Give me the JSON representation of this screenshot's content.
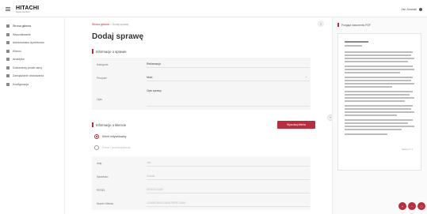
{
  "header": {
    "logo_main": "HITACHI",
    "logo_sub": "Inspire the Next",
    "user_name": "Jan Nowak"
  },
  "sidebar": {
    "items": [
      {
        "label": "Strona główna",
        "icon": "grid-icon"
      },
      {
        "label": "Wyszukiwanie",
        "icon": "search-icon"
      },
      {
        "label": "Administrator dyrektorów",
        "icon": "admin-icon"
      },
      {
        "label": "Klienci",
        "icon": "clients-icon"
      },
      {
        "label": "Analityka",
        "icon": "chart-icon"
      },
      {
        "label": "Dokumenty prośb ramy",
        "icon": "document-icon"
      },
      {
        "label": "Zarządzanie drukowania",
        "icon": "print-icon"
      },
      {
        "label": "Konfiguracja",
        "icon": "gear-icon"
      }
    ]
  },
  "main": {
    "breadcrumb": {
      "home": "Strona główna",
      "separator": ">",
      "current": "Dodaj sprawę"
    },
    "title": "Dodaj sprawę",
    "section1": {
      "title": "Informacje o sprawie",
      "rows": [
        {
          "label": "Kategoria",
          "value": "Reklamacja"
        },
        {
          "label": "Priorytet",
          "value": "Niski"
        },
        {
          "label": "Opis",
          "value": "Opis sprawy"
        }
      ]
    },
    "section2": {
      "title": "Informacje o kliencie",
      "button": "Wyszukaj klienta",
      "radio_options": [
        "Klient indywidualny",
        "Firma / przedsiębiorca"
      ],
      "rows": [
        {
          "label": "Imię",
          "value": "Jan"
        },
        {
          "label": "Nazwisko",
          "value": "Nowak"
        },
        {
          "label": "PESEL",
          "value": "80010112345"
        },
        {
          "label": "Numer klienta",
          "value": "12345678901234567890123456"
        }
      ]
    }
  },
  "preview": {
    "title": "Podgląd dokumentu PDF",
    "footer_note": "Strona 1 z 1"
  },
  "colors": {
    "accent": "#c0283a",
    "button": "#b92d3d"
  }
}
